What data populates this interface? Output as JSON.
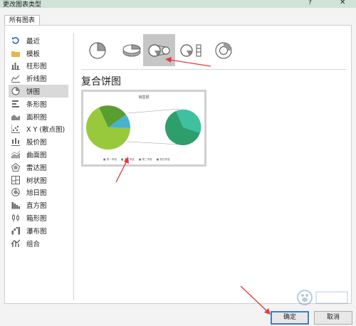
{
  "window": {
    "title": "更改图表类型",
    "help": "?",
    "close": "✕"
  },
  "tabs": [
    {
      "label": "所有图表"
    }
  ],
  "sidebar": {
    "items": [
      {
        "label": "最近",
        "icon": "recent-icon"
      },
      {
        "label": "模板",
        "icon": "template-folder-icon"
      },
      {
        "label": "柱形图",
        "icon": "column-chart-icon"
      },
      {
        "label": "折线图",
        "icon": "line-chart-icon"
      },
      {
        "label": "饼图",
        "icon": "pie-chart-icon",
        "selected": true
      },
      {
        "label": "条形图",
        "icon": "bar-chart-icon"
      },
      {
        "label": "面积图",
        "icon": "area-chart-icon"
      },
      {
        "label": "X Y (散点图)",
        "icon": "scatter-chart-icon"
      },
      {
        "label": "股价图",
        "icon": "stock-chart-icon"
      },
      {
        "label": "曲面图",
        "icon": "surface-chart-icon"
      },
      {
        "label": "雷达图",
        "icon": "radar-chart-icon"
      },
      {
        "label": "树状图",
        "icon": "treemap-icon"
      },
      {
        "label": "旭日图",
        "icon": "sunburst-icon"
      },
      {
        "label": "直方图",
        "icon": "histogram-icon"
      },
      {
        "label": "箱形图",
        "icon": "box-whisker-icon"
      },
      {
        "label": "瀑布图",
        "icon": "waterfall-icon"
      },
      {
        "label": "组合",
        "icon": "combo-chart-icon"
      }
    ]
  },
  "subtypes": [
    {
      "icon": "pie-icon"
    },
    {
      "icon": "3d-pie-icon"
    },
    {
      "icon": "pie-of-pie-icon",
      "selected": true
    },
    {
      "icon": "bar-of-pie-icon"
    },
    {
      "icon": "doughnut-icon"
    }
  ],
  "selected_subtype_name": "复合饼图",
  "preview": {
    "title": "销售额",
    "legend": [
      "■ 第一季度",
      "■ 第二季度",
      "■ 第三季度",
      "■ 第四季度"
    ],
    "colors": {
      "main_big": "#98c93c",
      "main_dark": "#5a9e32",
      "main_blue": "#47b3cf",
      "second_teal": "#3fc1a0",
      "second_green": "#2e9e6b"
    }
  },
  "buttons": {
    "ok": "确定",
    "cancel": "取消"
  },
  "annotation_color": "#e23b3b"
}
